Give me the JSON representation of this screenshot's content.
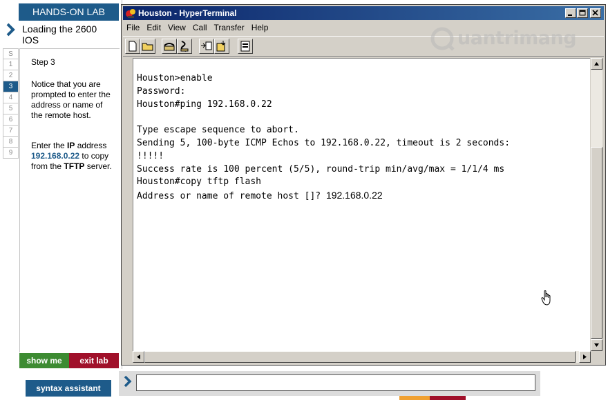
{
  "lab": {
    "header": "HANDS-ON LAB",
    "lesson_title": "Loading the 2600 IOS",
    "steps": [
      "S",
      "1",
      "2",
      "3",
      "4",
      "5",
      "6",
      "7",
      "8",
      "9"
    ],
    "active_step": "3",
    "step_label": "Step 3",
    "notice": "Notice that you are prompted to enter the address or name of the remote host.",
    "instruction_pre": "Enter the",
    "instruction_ip_word": "IP",
    "instruction_mid": "address",
    "instruction_ip_value": "192.168.0.22",
    "instruction_to": "to copy from the",
    "instruction_tftp": "TFTP",
    "instruction_post": "server.",
    "show_me": "show me",
    "exit_lab": "exit lab"
  },
  "terminal": {
    "window_title": "Houston - HyperTerminal",
    "menu": [
      "File",
      "Edit",
      "View",
      "Call",
      "Transfer",
      "Help"
    ],
    "lines": [
      "Houston>enable",
      "Password:",
      "Houston#ping 192.168.0.22",
      "",
      "Type escape sequence to abort.",
      "Sending 5, 100-byte ICMP Echos to 192.168.0.22, timeout is 2 seconds:",
      "!!!!!",
      "Success rate is 100 percent (5/5), round-trip min/avg/max = 1/1/4 ms",
      "Houston#copy tftp flash"
    ],
    "prompt_line": "Address or name of remote host []? ",
    "typed_input": "192.168.0.22"
  },
  "bottom": {
    "syntax_assistant": "syntax assistant",
    "command_value": ""
  },
  "watermark": "uantrimang",
  "colors": {
    "lab_blue": "#1e5b8a",
    "show_me_green": "#3d8b32",
    "exit_red": "#a0102a"
  }
}
